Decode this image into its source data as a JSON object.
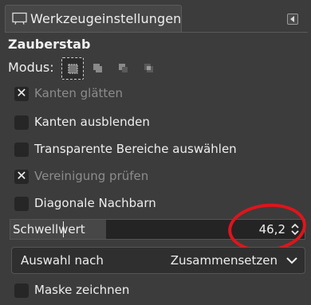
{
  "header": {
    "title": "Werkzeugeinstellungen",
    "icon": "tool-options-icon",
    "dock_icon": "dock-menu-icon"
  },
  "tool": {
    "name": "Zauberstab"
  },
  "mode": {
    "label": "Modus:",
    "buttons": [
      {
        "icon": "replace-selection-icon",
        "active": true
      },
      {
        "icon": "add-selection-icon",
        "active": false
      },
      {
        "icon": "subtract-selection-icon",
        "active": false
      },
      {
        "icon": "intersect-selection-icon",
        "active": false
      }
    ]
  },
  "options": [
    {
      "label": "Kanten glätten",
      "checked": true,
      "enabled": false
    },
    {
      "label": "Kanten ausblenden",
      "checked": false,
      "enabled": true
    },
    {
      "label": "Transparente Bereiche auswählen",
      "checked": false,
      "enabled": true
    },
    {
      "label": "Vereinigung prüfen",
      "checked": true,
      "enabled": false
    },
    {
      "label": "Diagonale Nachbarn",
      "checked": false,
      "enabled": true
    }
  ],
  "threshold": {
    "label": "Schwellwert",
    "value": "46,2"
  },
  "select_by": {
    "label": "Auswahl nach",
    "value": "Zusammensetzen"
  },
  "draw_mask": {
    "label": "Maske zeichnen",
    "checked": false
  },
  "colors": {
    "highlight_ring": "#e0141b",
    "panel_bg": "#3c3c3c",
    "text": "#eeeeee"
  }
}
